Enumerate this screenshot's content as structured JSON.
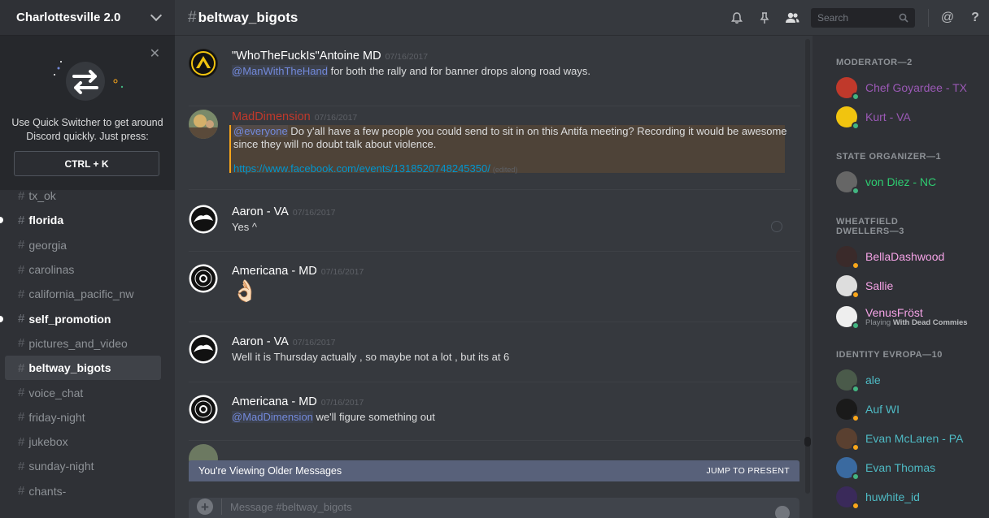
{
  "server": {
    "name": "Charlottesville 2.0"
  },
  "quick_switcher": {
    "text": "Use Quick Switcher to get around Discord quickly. Just press:",
    "shortcut": "CTRL + K"
  },
  "channels": [
    {
      "name": "tx_ok",
      "state": "normal"
    },
    {
      "name": "florida",
      "state": "unread"
    },
    {
      "name": "georgia",
      "state": "normal"
    },
    {
      "name": "carolinas",
      "state": "normal"
    },
    {
      "name": "california_pacific_nw",
      "state": "normal"
    },
    {
      "name": "self_promotion",
      "state": "unread"
    },
    {
      "name": "pictures_and_video",
      "state": "normal"
    },
    {
      "name": "beltway_bigots",
      "state": "active"
    },
    {
      "name": "voice_chat",
      "state": "normal"
    },
    {
      "name": "friday-night",
      "state": "normal"
    },
    {
      "name": "jukebox",
      "state": "normal"
    },
    {
      "name": "sunday-night",
      "state": "normal"
    },
    {
      "name": "chants-",
      "state": "normal"
    }
  ],
  "header": {
    "channel": "beltway_bigots",
    "search_placeholder": "Search"
  },
  "messages": [
    {
      "author": "\"WhoTheFuckIs\"Antoine MD",
      "time": "07/16/2017",
      "mention": "@ManWithTheHand",
      "text": " for both the rally and for banner drops along road ways."
    },
    {
      "author": "MadDimension",
      "time": "07/16/2017",
      "mention": "@everyone",
      "text": " Do y'all have a few people you could send to sit in on this Antifa meeting? Recording it would be awesome",
      "text2": "since they will no doubt talk about violence.",
      "link": "https://www.facebook.com/events/1318520748245350/",
      "edited": "(edited)"
    },
    {
      "author": "Aaron - VA",
      "time": "07/16/2017",
      "text": "Yes ^"
    },
    {
      "author": "Americana - MD",
      "time": "07/16/2017",
      "text": "👌🏻"
    },
    {
      "author": "Aaron - VA",
      "time": "07/16/2017",
      "text": "Well it is Thursday actually , so maybe not a lot , but its at 6"
    },
    {
      "author": "Americana - MD",
      "time": "07/16/2017",
      "mention": "@MadDimension",
      "text": " we'll figure something out"
    }
  ],
  "older_bar": {
    "text": "You're Viewing Older Messages",
    "jump": "JUMP TO PRESENT"
  },
  "composer": {
    "placeholder": "Message #beltway_bigots"
  },
  "members": {
    "roles": [
      {
        "label": "MODERATOR—2"
      },
      {
        "label": "STATE ORGANIZER—1"
      },
      {
        "label": "WHEATFIELD DWELLERS—3"
      },
      {
        "label": "IDENTITY EVROPA—10"
      }
    ],
    "list": [
      {
        "name": "Chef Goyardee - TX",
        "color": "#9b59b6",
        "status": "online"
      },
      {
        "name": "Kurt - VA",
        "color": "#9b59b6",
        "status": "online"
      },
      {
        "name": "von Diez - NC",
        "color": "#2ecc71",
        "status": "online"
      },
      {
        "name": "BellaDashwood",
        "color": "#f5a3e6",
        "status": "idle"
      },
      {
        "name": "Sallie",
        "color": "#f5a3e6",
        "status": "idle"
      },
      {
        "name": "VenusFröst",
        "color": "#f5a3e6",
        "status": "online",
        "activity_prefix": "Playing ",
        "activity": "With Dead Commies"
      },
      {
        "name": "ale",
        "color": "#4ebac4",
        "status": "online"
      },
      {
        "name": "Auf WI",
        "color": "#4ebac4",
        "status": "idle"
      },
      {
        "name": "Evan McLaren - PA",
        "color": "#4ebac4",
        "status": "idle"
      },
      {
        "name": "Evan Thomas",
        "color": "#4ebac4",
        "status": "online"
      },
      {
        "name": "huwhite_id",
        "color": "#4ebac4",
        "status": "idle"
      }
    ]
  }
}
